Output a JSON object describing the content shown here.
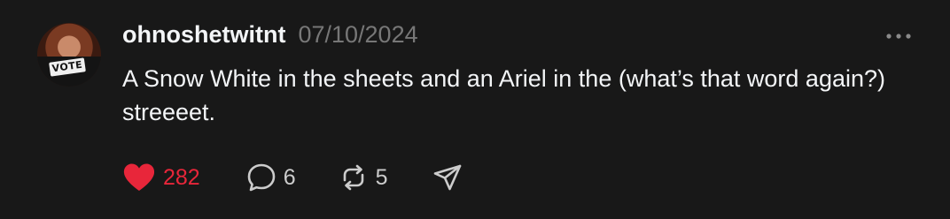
{
  "post": {
    "username": "ohnoshetwitnt",
    "date": "07/10/2024",
    "text": "A Snow White in the sheets and an Ariel in the (what’s that word again?) streeeet.",
    "avatar_badge": "VOTE",
    "likes": "282",
    "replies": "6",
    "reposts": "5",
    "liked": true
  },
  "icons": {
    "like": "heart-filled-icon",
    "reply": "speech-bubble-icon",
    "repost": "repost-arrows-icon",
    "share": "paper-plane-icon",
    "more": "more-dots-icon"
  },
  "colors": {
    "background": "#181818",
    "like_active": "#e8263a",
    "secondary_text": "#777777",
    "primary_text": "#f3f5f7"
  }
}
